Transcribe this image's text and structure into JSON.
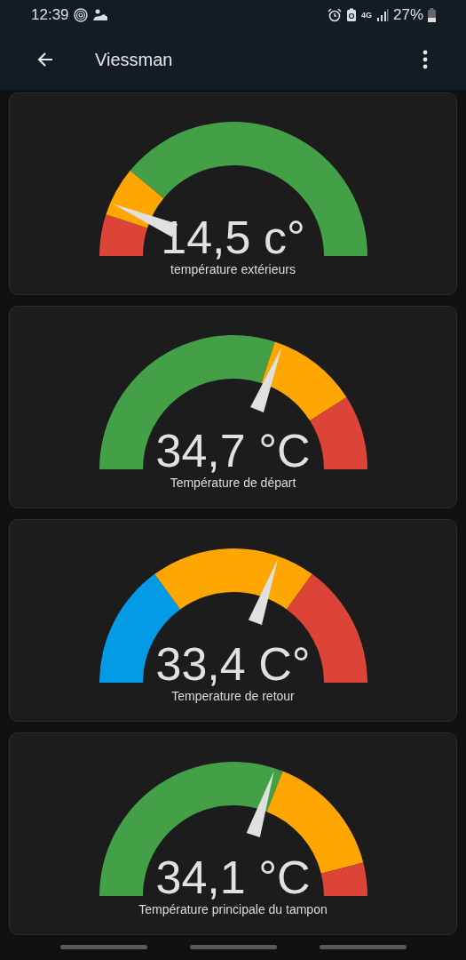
{
  "status_bar": {
    "time": "12:39",
    "network": "4G",
    "battery": "27%"
  },
  "app_bar": {
    "title": "Viessman"
  },
  "gauges": [
    {
      "value": "14,5 c°",
      "label": "température extérieurs",
      "segments": [
        {
          "color": "#db4437"
        },
        {
          "color": "#ffa600"
        },
        {
          "color": "#43a047"
        }
      ]
    },
    {
      "value": "34,7 °C",
      "label": "Température de départ",
      "segments": [
        {
          "color": "#43a047"
        },
        {
          "color": "#ffa600"
        },
        {
          "color": "#db4437"
        }
      ]
    },
    {
      "value": "33,4 C°",
      "label": "Temperature de retour",
      "segments": [
        {
          "color": "#039be5"
        },
        {
          "color": "#ffa600"
        },
        {
          "color": "#db4437"
        }
      ]
    },
    {
      "value": "34,1 °C",
      "label": "Température principale du tampon",
      "segments": [
        {
          "color": "#43a047"
        },
        {
          "color": "#ffa600"
        },
        {
          "color": "#db4437"
        }
      ]
    }
  ]
}
